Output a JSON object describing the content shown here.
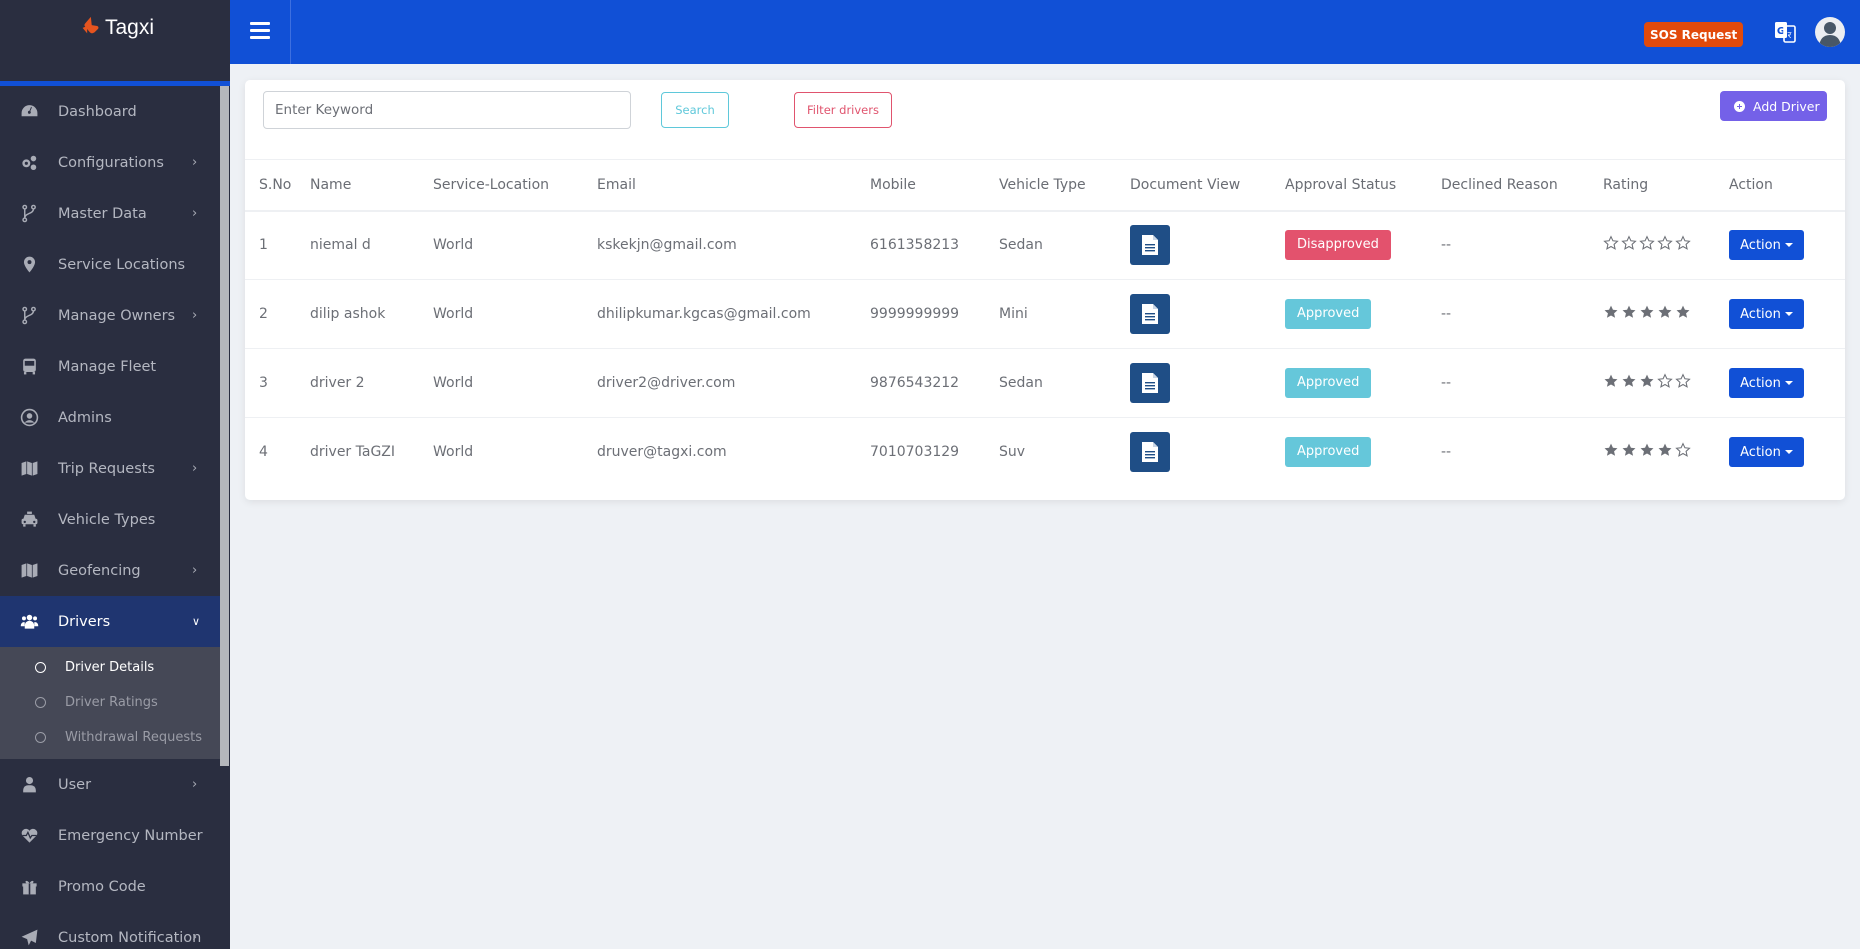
{
  "brand": {
    "name": "Tagxi",
    "logo_icon": "handshake-icon"
  },
  "sidebar": {
    "items": [
      {
        "label": "Dashboard",
        "icon": "dashboard-gauge-icon",
        "has_children": false
      },
      {
        "label": "Configurations",
        "icon": "cogs-icon",
        "has_children": true
      },
      {
        "label": "Master Data",
        "icon": "code-branch-icon",
        "has_children": true
      },
      {
        "label": "Service Locations",
        "icon": "map-marker-icon",
        "has_children": false
      },
      {
        "label": "Manage Owners",
        "icon": "code-branch-icon",
        "has_children": true
      },
      {
        "label": "Manage Fleet",
        "icon": "bus-icon",
        "has_children": false
      },
      {
        "label": "Admins",
        "icon": "user-circle-icon",
        "has_children": false
      },
      {
        "label": "Trip Requests",
        "icon": "map-icon",
        "has_children": true
      },
      {
        "label": "Vehicle Types",
        "icon": "taxi-icon",
        "has_children": false
      },
      {
        "label": "Geofencing",
        "icon": "map-icon",
        "has_children": true
      },
      {
        "label": "Drivers",
        "icon": "users-icon",
        "has_children": true,
        "expanded": true,
        "active": true
      },
      {
        "label": "User",
        "icon": "user-icon",
        "has_children": true
      },
      {
        "label": "Emergency Number",
        "icon": "heartbeat-icon",
        "has_children": false
      },
      {
        "label": "Promo Code",
        "icon": "gift-icon",
        "has_children": false
      },
      {
        "label": "Custom Notification",
        "icon": "paper-plane-icon",
        "has_children": true
      }
    ],
    "drivers_submenu": [
      {
        "label": "Driver Details",
        "active": true
      },
      {
        "label": "Driver Ratings",
        "active": false
      },
      {
        "label": "Withdrawal Requests",
        "active": false
      }
    ]
  },
  "topbar": {
    "menu_icon": "hamburger-icon",
    "sos_label": "SOS Request",
    "translate_icon": "google-translate-icon",
    "avatar_icon": "user-avatar-icon"
  },
  "toolbar": {
    "keyword_value": "",
    "keyword_placeholder": "Enter Keyword",
    "search_label": "Search",
    "filter_label": "Filter drivers",
    "add_label": "Add Driver"
  },
  "table": {
    "headers": [
      "S.No",
      "Name",
      "Service-Location",
      "Email",
      "Mobile",
      "Vehicle Type",
      "Document View",
      "Approval Status",
      "Declined Reason",
      "Rating",
      "Action"
    ],
    "rows": [
      {
        "sno": "1",
        "name": "niemal d",
        "location": "World",
        "email": "kskekjn@gmail.com",
        "mobile": "6161358213",
        "vehicle": "Sedan",
        "status": "Disapproved",
        "declined": "--",
        "rating": 0,
        "action": "Action"
      },
      {
        "sno": "2",
        "name": "dilip ashok",
        "location": "World",
        "email": "dhilipkumar.kgcas@gmail.com",
        "mobile": "9999999999",
        "vehicle": "Mini",
        "status": "Approved",
        "declined": "--",
        "rating": 5,
        "action": "Action"
      },
      {
        "sno": "3",
        "name": "driver 2",
        "location": "World",
        "email": "driver2@driver.com",
        "mobile": "9876543212",
        "vehicle": "Sedan",
        "status": "Approved",
        "declined": "--",
        "rating": 3,
        "action": "Action"
      },
      {
        "sno": "4",
        "name": "driver TaGZI",
        "location": "World",
        "email": "druver@tagxi.com",
        "mobile": "7010703129",
        "vehicle": "Suv",
        "status": "Approved",
        "declined": "--",
        "rating": 4,
        "action": "Action"
      }
    ],
    "rating_max": 5
  },
  "colors": {
    "primary": "#1150d6",
    "sidebar_bg": "#2a2e40",
    "sidebar_active": "#1f3570",
    "submenu_bg": "#454856",
    "sos": "#e24a0b",
    "add_button": "#7461e8",
    "disapproved": "#e3526d",
    "approved": "#65c7da",
    "doc_button": "#1f4e86",
    "star": "#6c6f76"
  }
}
